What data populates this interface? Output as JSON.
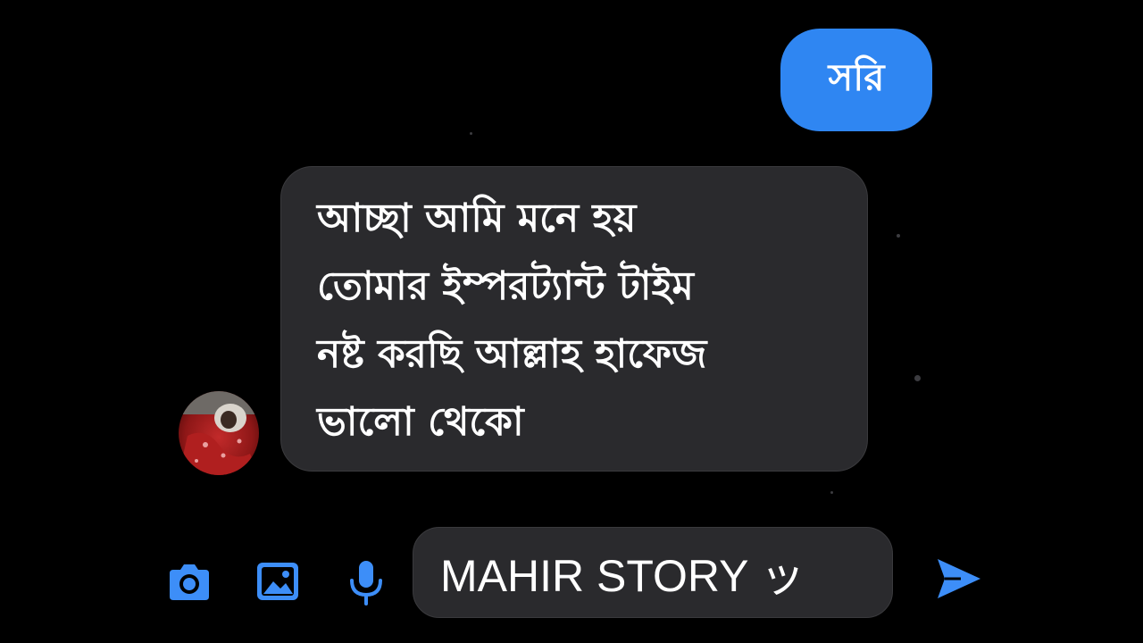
{
  "conversation": {
    "sent_message": "সরি",
    "received_message": {
      "lines": [
        "আচ্ছা আমি মনে হয়",
        "তোমার ইম্পরট্যান্ট টাইম",
        "নষ্ট করছি আল্লাহ হাফেজ",
        "ভালো থেকো"
      ]
    }
  },
  "composer": {
    "input_text": "MAHIR STORY ッ",
    "icons": [
      "camera-icon",
      "image-icon",
      "microphone-icon",
      "send-icon"
    ]
  },
  "colors": {
    "background": "#000000",
    "sent_bubble": "#2f86f2",
    "received_bubble": "#2a2a2d",
    "accent_icon": "#3d8ef8"
  }
}
